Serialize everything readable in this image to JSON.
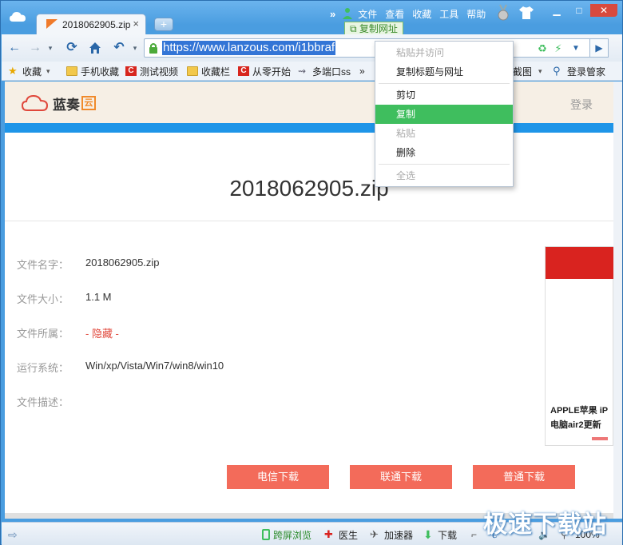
{
  "tab": {
    "title": "2018062905.zip"
  },
  "menu": {
    "items": [
      "文件",
      "查看",
      "收藏",
      "工具",
      "帮助"
    ]
  },
  "tooltip": {
    "copy_url": "复制网址"
  },
  "address": {
    "url": "https://www.lanzous.com/i1bbraf"
  },
  "bookmarks": [
    {
      "label": "收藏"
    },
    {
      "label": "手机收藏"
    },
    {
      "label": "测试视频"
    },
    {
      "label": "收藏栏"
    },
    {
      "label": "从零开始"
    },
    {
      "label": "多端口ss"
    },
    {
      "label": "截图"
    },
    {
      "label": "登录管家"
    }
  ],
  "context_menu": {
    "items": [
      {
        "label": "粘贴并访问",
        "state": "disabled"
      },
      {
        "label": "复制标题与网址",
        "state": "enabled"
      },
      {
        "label": "剪切",
        "state": "enabled"
      },
      {
        "label": "复制",
        "state": "highlighted"
      },
      {
        "label": "粘贴",
        "state": "disabled"
      },
      {
        "label": "删除",
        "state": "enabled"
      },
      {
        "label": "全选",
        "state": "disabled"
      }
    ]
  },
  "site": {
    "logo_text": "蓝奏",
    "logo_badge": "云",
    "login": "登录"
  },
  "file": {
    "title": "2018062905.zip",
    "rows": [
      {
        "label": "文件名字：",
        "value": "2018062905.zip"
      },
      {
        "label": "文件大小：",
        "value": "1.1 M"
      },
      {
        "label": "文件所属：",
        "value": "- 隐藏 -"
      },
      {
        "label": "运行系统：",
        "value": "Win/xp/Vista/Win7/win8/win10"
      },
      {
        "label": "文件描述：",
        "value": ""
      }
    ]
  },
  "ad": {
    "line1": "APPLE苹果 iP",
    "line2": "电脑air2更新"
  },
  "download_buttons": [
    "电信下载",
    "联通下载",
    "普通下载"
  ],
  "statusbar": {
    "split_view": "跨屏浏览",
    "doctor": "医生",
    "accelerator": "加速器",
    "download": "下载",
    "zoom": "100%"
  },
  "watermark": "极速下载站",
  "colors": {
    "accent_green": "#3fbe5e",
    "download_red": "#f36b5a",
    "site_blue": "#1f95e8"
  }
}
